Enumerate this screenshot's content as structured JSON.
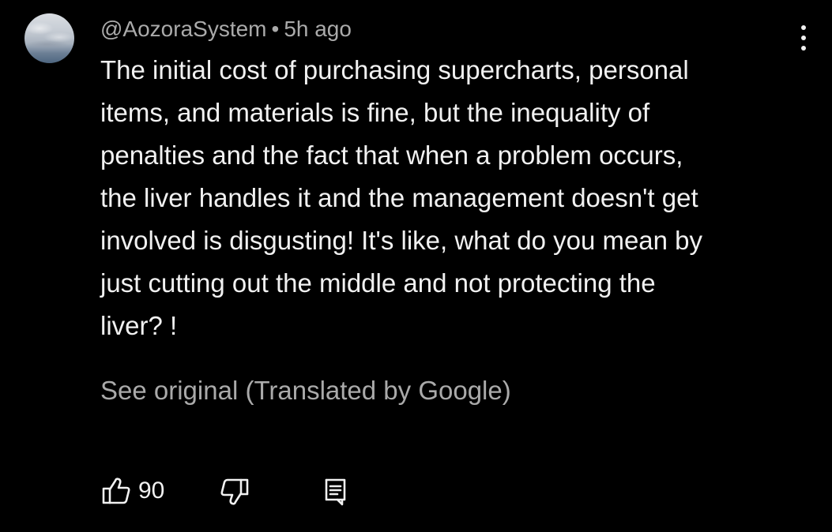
{
  "comment": {
    "author": "@AozoraSystem",
    "separator": "•",
    "time": "5h ago",
    "lines": [
      "The initial cost of purchasing supercharts, personal",
      "items, and materials is fine, but the inequality of",
      "penalties and the fact that when a problem occurs,",
      "the liver handles it and the management doesn't get",
      "involved is disgusting! It's like, what do you mean by",
      "just cutting out the middle and not protecting the",
      "liver? !"
    ],
    "see_original": "See original (Translated by Google)",
    "like_count": "90"
  },
  "icons": {
    "avatar": "avatar-sky-image",
    "more": "more-vertical-icon",
    "like": "thumbs-up-icon",
    "dislike": "thumbs-down-icon",
    "reply": "reply-comment-icon"
  },
  "colors": {
    "background": "#000000",
    "primary_text": "#f1f1f1",
    "secondary_text": "#aaaaaa"
  }
}
